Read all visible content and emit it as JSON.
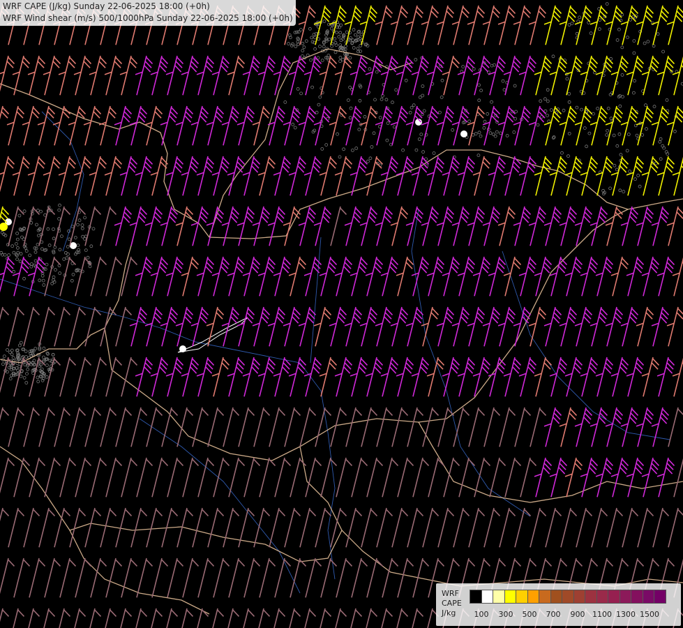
{
  "header": {
    "line1": "WRF CAPE (J/kg) Sunday 22-06-2025 18:00 (+0h)",
    "line2": "WRF Wind shear (m/s) 500/1000hPa Sunday 22-06-2025 18:00 (+0h)"
  },
  "legend": {
    "model": "WRF",
    "field": "CAPE",
    "unit": "J/kg",
    "tick_labels": [
      "100",
      "300",
      "500",
      "700",
      "900",
      "1100",
      "1300",
      "1500"
    ],
    "colors": [
      "#000000",
      "#ffffff",
      "#ffffa8",
      "#ffff00",
      "#ffd000",
      "#ffa000",
      "#c86a1e",
      "#a0501e",
      "#a04a28",
      "#9e4032",
      "#9c3240",
      "#9a2a4a",
      "#962050",
      "#8c1a5a",
      "#84105e",
      "#7a0a66",
      "#740066"
    ]
  },
  "map": {
    "background_color": "#000000",
    "border_color": "#f0c8a0",
    "river_color": "#3a6fd8",
    "barb_colors": {
      "low": "#9a6a74",
      "medium": "#e07a70",
      "high": "#d028d8",
      "very_high": "#f0f000"
    },
    "icons": [
      "wind-barb-icon",
      "cape-speckle-icon"
    ]
  }
}
